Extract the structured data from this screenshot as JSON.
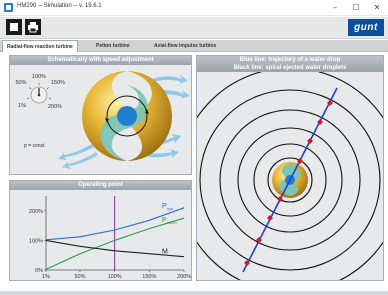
{
  "window": {
    "title": "HM290  --  Simulation -- v. 19.6.1",
    "controls": {
      "minimize": "–",
      "maximize": "☐",
      "close": "✕"
    }
  },
  "toolbar": {
    "stop_icon": "stop-icon",
    "print_icon": "printer-icon",
    "logo_text": "gunt"
  },
  "tabs": [
    {
      "label": "Radial-flow reaction turbine",
      "active": true
    },
    {
      "label": "Pelton turbine",
      "active": false
    },
    {
      "label": "Axial-flow impulse turbine",
      "active": false
    }
  ],
  "schematic_panel": {
    "title": "Schematically with speed adjustment",
    "dial_labels": [
      "100%",
      "50%",
      "150%",
      "1%",
      "200%"
    ],
    "pressure_label": "p = const",
    "colors": {
      "rotor": "#e3b53a",
      "casing": "#79c4b4",
      "hub": "#1f7fd0",
      "flow_arrows": "#8ec8ea"
    }
  },
  "operating_panel": {
    "title": "Operating point",
    "chart_data": {
      "type": "line",
      "x_ticks": [
        "1%",
        "50%",
        "100%",
        "150%",
        "200%"
      ],
      "y_ticks": [
        "0%",
        "100%",
        "200%"
      ],
      "xlim": [
        1,
        200
      ],
      "ylim": [
        0,
        250
      ],
      "operating_point_x": 100,
      "series": [
        {
          "name": "P_hyd",
          "sub": "hyd",
          "color": "#2a6fd6",
          "x": [
            1,
            50,
            100,
            150,
            200
          ],
          "y": [
            102,
            112,
            135,
            168,
            210
          ]
        },
        {
          "name": "P_mech",
          "sub": "mech",
          "color": "#2a9d50",
          "x": [
            1,
            50,
            100,
            150,
            200
          ],
          "y": [
            2,
            55,
            100,
            140,
            175
          ]
        },
        {
          "name": "M",
          "sub": "",
          "color": "#222222",
          "x": [
            1,
            50,
            100,
            150,
            200
          ],
          "y": [
            100,
            80,
            65,
            55,
            45
          ]
        }
      ],
      "marker_color": "#8a2c9e"
    }
  },
  "trajectory_panel": {
    "title_line1": "Blue line: trajectory of a water drop",
    "title_line2": "Black line: spiral ejected water droplets",
    "colors": {
      "trajectory": "#1e3fd8",
      "spiral": "#111111",
      "drops": "#d4182b"
    }
  }
}
